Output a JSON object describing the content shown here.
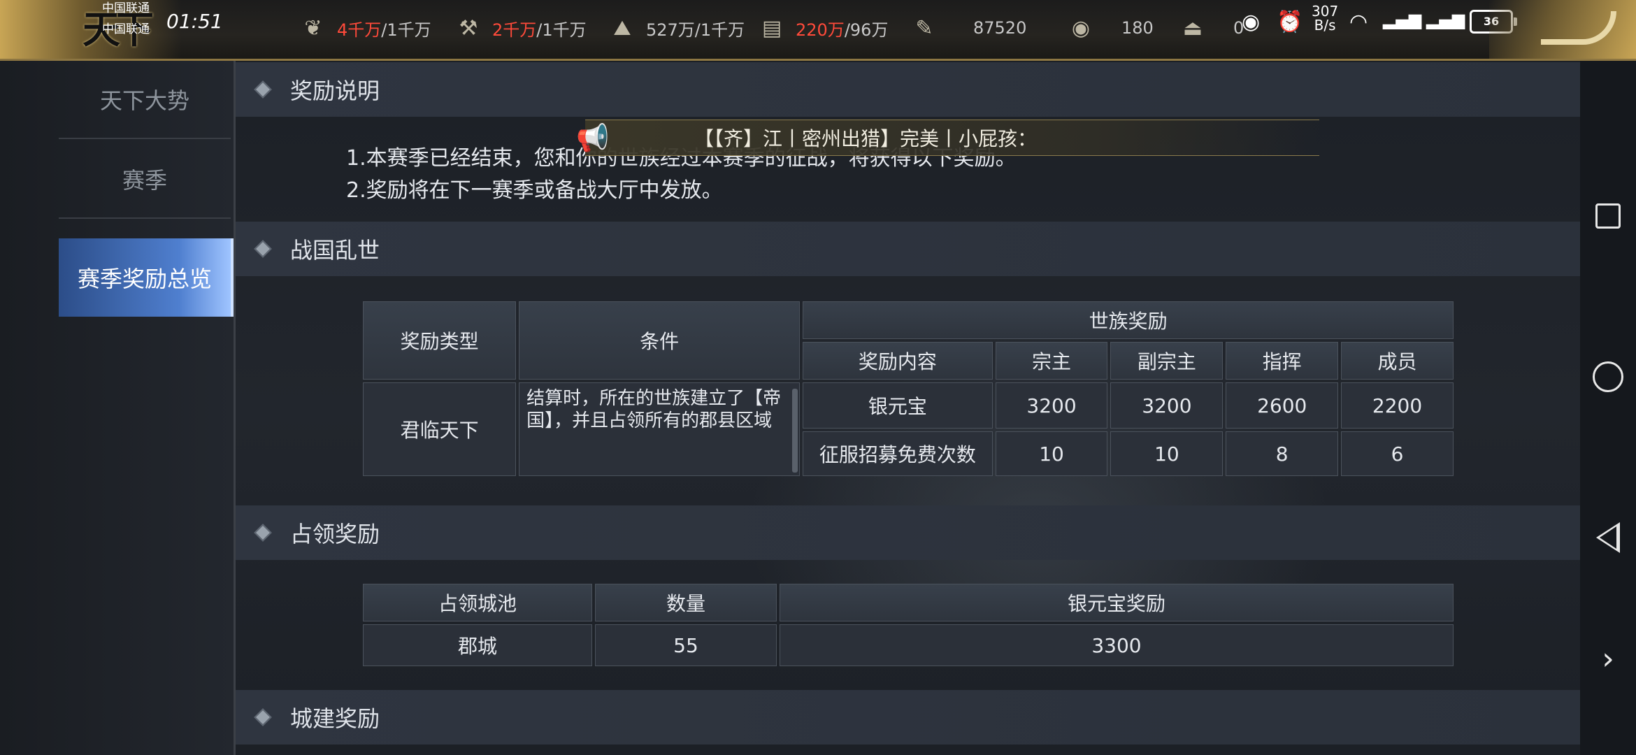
{
  "status_bar": {
    "carrier1": "中国联通",
    "carrier2": "中国联通",
    "time": "01:51",
    "net_speed_value": "307",
    "net_speed_unit": "B/s",
    "battery": "36"
  },
  "logo_text": "天下",
  "resources": [
    {
      "icon": "grain-icon",
      "current": "4千万",
      "cap": "/1千万"
    },
    {
      "icon": "wood-icon",
      "current": "2千万",
      "cap": "/1千万"
    },
    {
      "icon": "stone-icon",
      "current": "",
      "cap": "527万/1千万"
    },
    {
      "icon": "iron-icon",
      "current": "220万",
      "cap": "/96万"
    },
    {
      "icon": "scroll-icon",
      "current": "",
      "cap": "87520"
    },
    {
      "icon": "coin-icon",
      "current": "",
      "cap": "180"
    },
    {
      "icon": "ingot-icon",
      "current": "",
      "cap": "0"
    }
  ],
  "sidebar": {
    "items": [
      {
        "label": "天下大势"
      },
      {
        "label": "赛季"
      },
      {
        "label": "赛季奖励总览",
        "active": true
      }
    ]
  },
  "sections": {
    "reward_desc": {
      "title": "奖励说明",
      "lines": [
        "1.本赛季已经结束，您和你的世族经过本赛季的征战，将获得以下奖励。",
        "2.奖励将在下一赛季或备战大厅中发放。"
      ]
    },
    "warring": {
      "title": "战国乱世",
      "headers": {
        "type": "奖励类型",
        "condition": "条件",
        "clan_reward": "世族奖励",
        "content": "奖励内容",
        "roles": [
          "宗主",
          "副宗主",
          "指挥",
          "成员"
        ]
      },
      "row": {
        "type": "君临天下",
        "condition": "结算时，所在的世族建立了【帝国】，并且占领所有的郡县区域",
        "rewards": [
          {
            "name": "银元宝",
            "values": [
              "3200",
              "3200",
              "2600",
              "2200"
            ]
          },
          {
            "name": "征服招募免费次数",
            "values": [
              "10",
              "10",
              "8",
              "6"
            ]
          }
        ]
      }
    },
    "occupy": {
      "title": "占领奖励",
      "headers": [
        "占领城池",
        "数量",
        "银元宝奖励"
      ],
      "rows": [
        [
          "郡城",
          "55",
          "3300"
        ]
      ]
    },
    "build": {
      "title": "城建奖励"
    }
  },
  "broadcast": {
    "message": "【【齐】江丨密州出猎】完美丨小屁孩："
  },
  "colors": {
    "accent_gold": "#8d7642",
    "active_tab": "#4f7fcf",
    "resource_over_cap": "#ff4a3a"
  }
}
